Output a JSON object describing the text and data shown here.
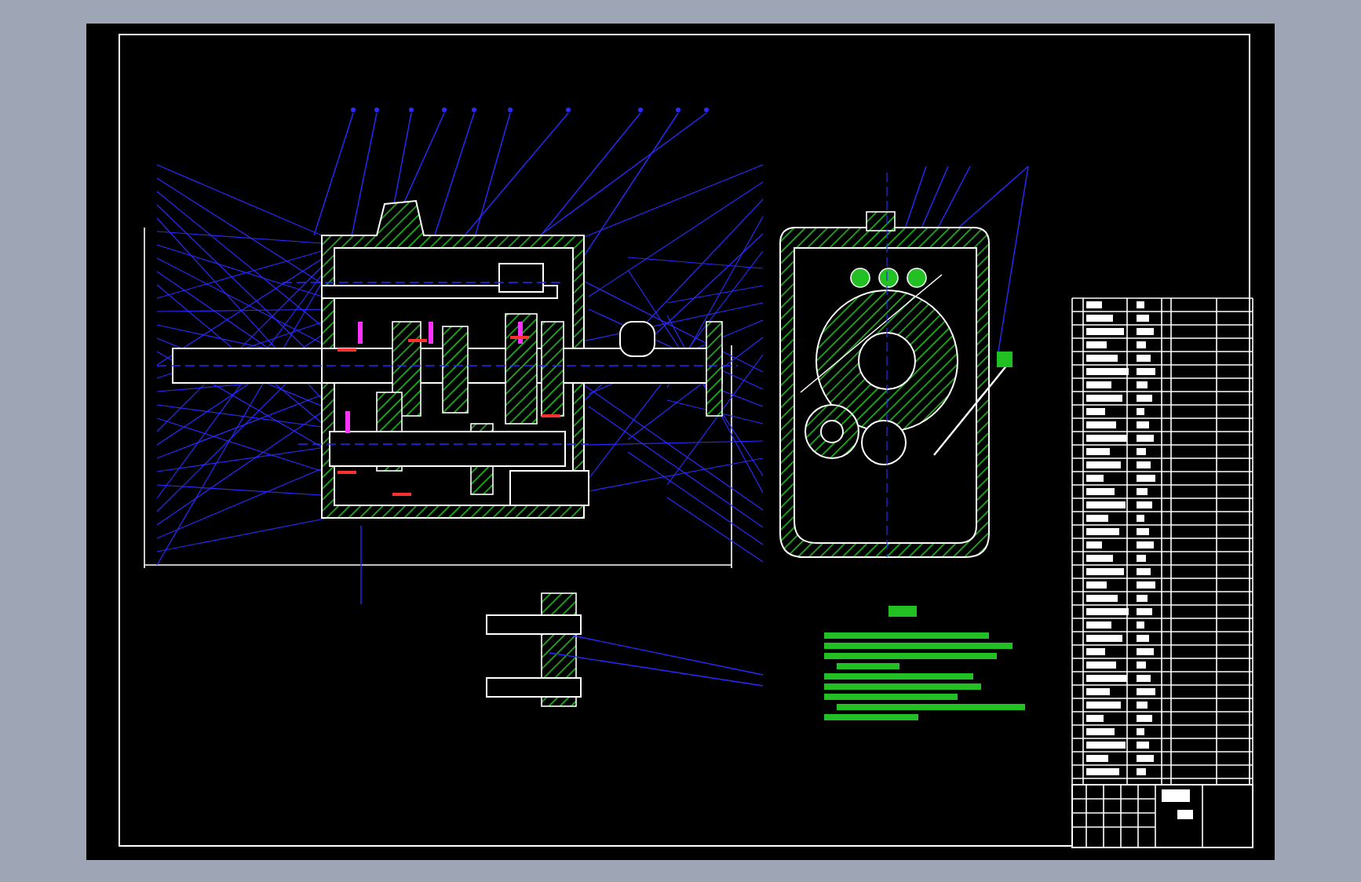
{
  "sheet": {
    "views": [
      {
        "kind": "section"
      },
      {
        "kind": "end"
      },
      {
        "kind": "detail"
      },
      {
        "kind": "notes"
      },
      {
        "kind": "parts-list"
      }
    ]
  }
}
